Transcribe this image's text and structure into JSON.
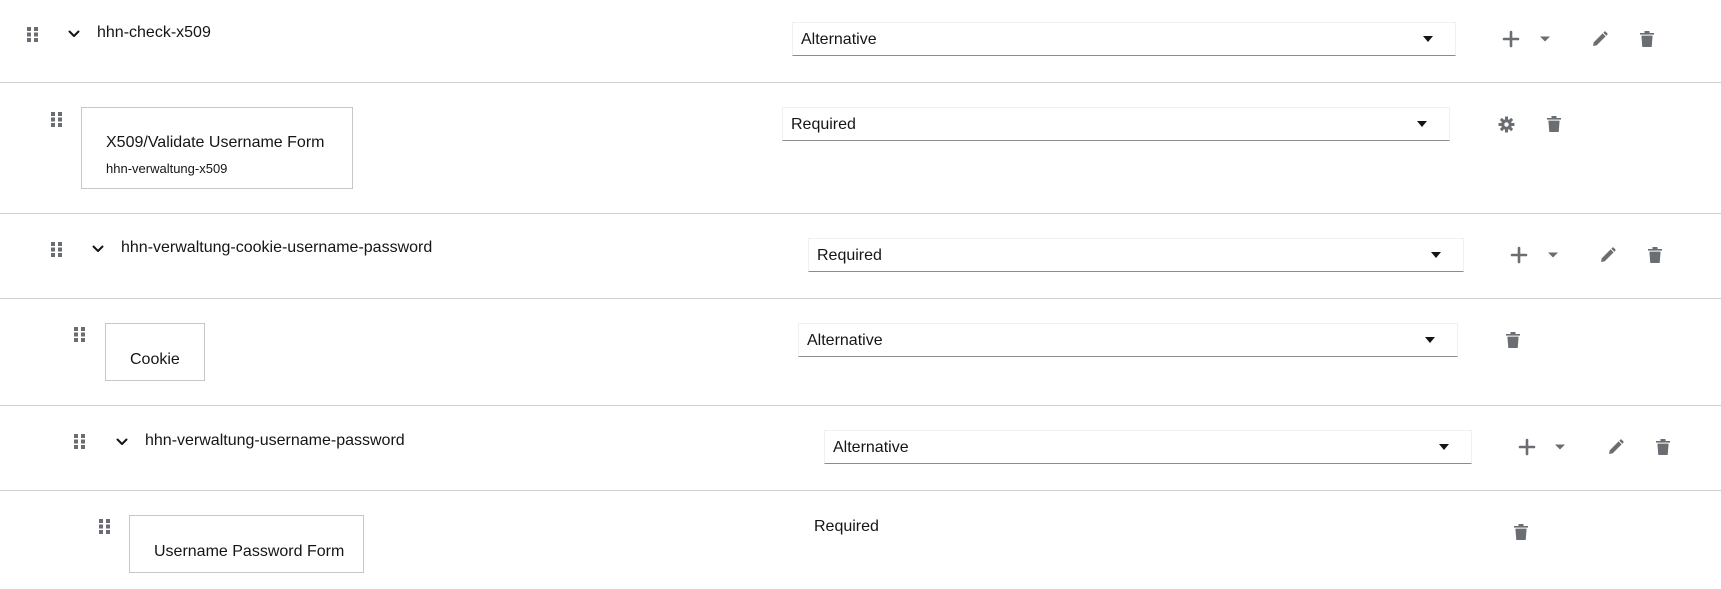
{
  "colors": {
    "icon": "#6a6e73",
    "text": "#151515",
    "divider": "#d2d2d2",
    "card_border": "#c7c7c7",
    "select_underline": "#8a8d90"
  },
  "rows": [
    {
      "kind": "flow",
      "title": "hhn-check-x509",
      "requirement": "Alternative",
      "actions": [
        "plus-icon",
        "caret-down-icon",
        "pencil-icon",
        "trash-icon"
      ]
    },
    {
      "kind": "execution",
      "title": "X509/Validate Username Form",
      "subtitle": "hhn-verwaltung-x509",
      "requirement": "Required",
      "actions": [
        "gear-icon",
        "trash-icon"
      ]
    },
    {
      "kind": "flow",
      "title": "hhn-verwaltung-cookie-username-password",
      "requirement": "Required",
      "actions": [
        "plus-icon",
        "caret-down-icon",
        "pencil-icon",
        "trash-icon"
      ]
    },
    {
      "kind": "execution",
      "title": "Cookie",
      "requirement": "Alternative",
      "actions": [
        "trash-icon"
      ]
    },
    {
      "kind": "flow",
      "title": "hhn-verwaltung-username-password",
      "requirement": "Alternative",
      "actions": [
        "plus-icon",
        "caret-down-icon",
        "pencil-icon",
        "trash-icon"
      ]
    },
    {
      "kind": "execution",
      "title": "Username Password Form",
      "requirement": "Required",
      "actions": [
        "trash-icon"
      ]
    }
  ]
}
